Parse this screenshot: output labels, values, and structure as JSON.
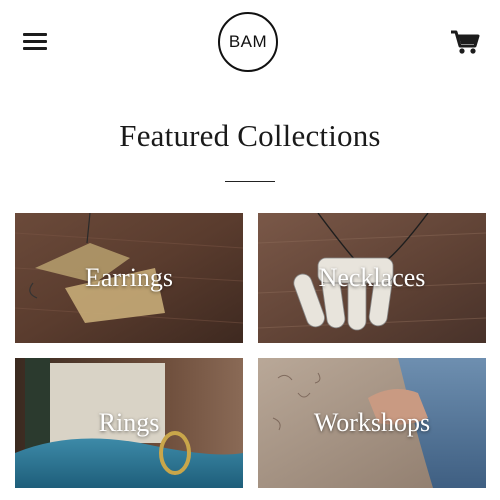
{
  "header": {
    "logo_text": "BAM",
    "menu_icon": "hamburger-menu-icon",
    "cart_icon": "shopping-cart-icon"
  },
  "main": {
    "title": "Featured Collections",
    "collections": [
      {
        "label": "Earrings"
      },
      {
        "label": "Necklaces"
      },
      {
        "label": "Rings"
      },
      {
        "label": "Workshops"
      }
    ]
  },
  "colors": {
    "text": "#1a1a1a",
    "tile_text": "#ffffff"
  }
}
